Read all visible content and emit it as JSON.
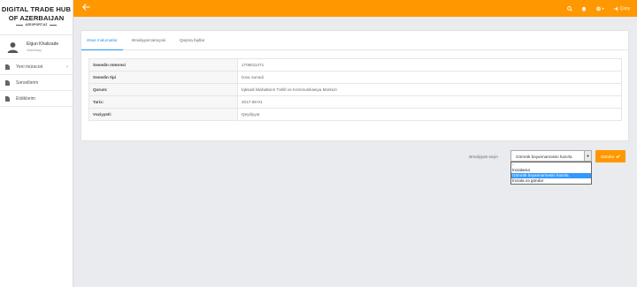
{
  "brand": {
    "line1": "DIGITAL TRADE HUB",
    "line2": "OF AZERBAIJAN",
    "sub": "AZEXPORT.AZ"
  },
  "user": {
    "name": "Elgun Khalizade",
    "role": "Valeedag"
  },
  "nav": [
    {
      "label": "Yeni müraciət",
      "has_chevron": true
    },
    {
      "label": "Sənədlərim",
      "has_chevron": false
    },
    {
      "label": "Etdiklərim",
      "has_chevron": false
    }
  ],
  "topbar": {
    "exit_label": "Çıxış",
    "accent_color": "#ff9800"
  },
  "tabs": [
    {
      "label": "Əsas məlumatlar",
      "active": true
    },
    {
      "label": "Əməliyyat tarixçəsi",
      "active": false
    },
    {
      "label": "Qoşma fayllar",
      "active": false
    }
  ],
  "info_rows": [
    {
      "key": "Sənədin nömrəsi",
      "value": "1708011471"
    },
    {
      "key": "Sənədin tipi",
      "value": "İxrac sənədi"
    },
    {
      "key": "Qurum:",
      "value": "İqtisadi İslahatların Təhlil və Kommunikasiya Mərkəzi"
    },
    {
      "key": "Tarix:",
      "value": "2017-08-01"
    },
    {
      "key": "Vəziyyəti:",
      "value": "Qeydiyyat"
    }
  ],
  "action": {
    "label": "Əməliyyatı seçin",
    "selected": "Gömrük bəyannaməsini hazırla",
    "options": [
      "-",
      "İmzalama",
      "Gömrük bəyannaməsini hazırla",
      "İmzala və göndər"
    ],
    "button_label": "Göndər"
  }
}
